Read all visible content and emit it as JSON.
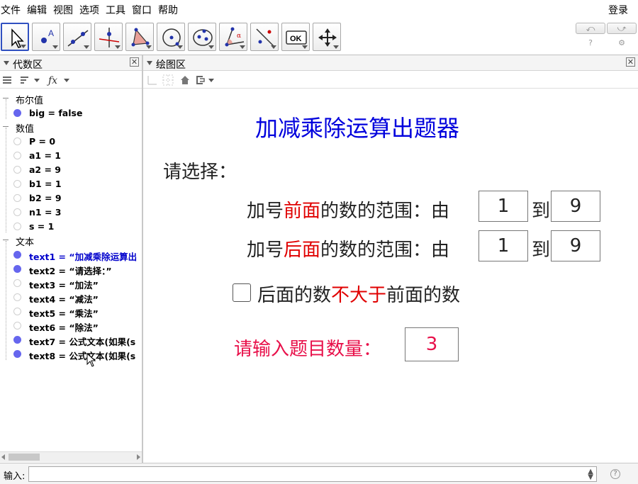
{
  "menu": {
    "items": [
      "文件",
      "编辑",
      "视图",
      "选项",
      "工具",
      "窗口",
      "帮助"
    ],
    "login": "登录"
  },
  "toolbar": {
    "tools": [
      "move-tool-icon",
      "point-tool-icon",
      "line-tool-icon",
      "perpendicular-tool-icon",
      "polygon-tool-icon",
      "circle-tool-icon",
      "conic-tool-icon",
      "angle-tool-icon",
      "reflect-tool-icon",
      "ok-tool-icon",
      "move-graphics-tool-icon"
    ],
    "ok_label": "OK",
    "undo_icon": "undo-icon",
    "redo_icon": "redo-icon"
  },
  "algebra": {
    "title": "代数区",
    "categories": {
      "boolean": "布尔值",
      "number": "数值",
      "text": "文本"
    },
    "boolean_items": [
      {
        "label": "big = false",
        "visible": true
      }
    ],
    "number_items": [
      {
        "label": "P = 0",
        "visible": false
      },
      {
        "label": "a1 = 1",
        "visible": false
      },
      {
        "label": "a2 = 9",
        "visible": false
      },
      {
        "label": "b1 = 1",
        "visible": false
      },
      {
        "label": "b2 = 9",
        "visible": false
      },
      {
        "label": "n1 = 3",
        "visible": false
      },
      {
        "label": "s = 1",
        "visible": false
      }
    ],
    "text_items": [
      {
        "label": "text1 = “加减乘除运算出",
        "visible": true,
        "selected": true
      },
      {
        "label": "text2 = “请选择：”",
        "visible": true
      },
      {
        "label": "text3 = “加法”",
        "visible": false
      },
      {
        "label": "text4 = “减法”",
        "visible": false
      },
      {
        "label": "text5 = “乘法”",
        "visible": false
      },
      {
        "label": "text6 = “除法”",
        "visible": false
      },
      {
        "label": "text7 = 公式文本(如果(s",
        "visible": true
      },
      {
        "label": "text8 = 公式文本(如果(s",
        "visible": true
      }
    ]
  },
  "graphics": {
    "title": "绘图区",
    "heading": "加减乘除运算出题器",
    "prompt": "请选择：",
    "range1": {
      "pre": "加号",
      "highlight": "前面",
      "post": "的数的范围：由",
      "from": "1",
      "to_word": "到",
      "to": "9"
    },
    "range2": {
      "pre": "加号",
      "highlight": "后面",
      "post": "的数的范围：由",
      "from": "1",
      "to_word": "到",
      "to": "9"
    },
    "checkbox": {
      "pre": "后面的数",
      "highlight": "不大于",
      "post": "前面的数",
      "checked": false
    },
    "count_label": "请输入题目数量：",
    "count_value": "3"
  },
  "input": {
    "label": "输入:",
    "value": ""
  },
  "colors": {
    "title_blue": "#0000dd",
    "highlight_red": "#e00000",
    "count_pink": "#e8104a",
    "selected_blue": "#0000cc",
    "visible_dot": "#6666ee"
  }
}
